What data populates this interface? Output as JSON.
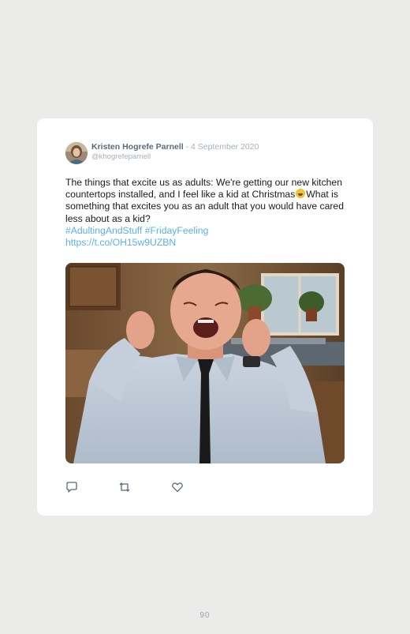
{
  "tweet": {
    "author_name": "Kristen Hogrefe Parnell",
    "separator": " - ",
    "date": "4 September 2020",
    "handle": "@khogrefeparnell",
    "text_before_emoji": "The things that excite us as adults: We're getting our new kitchen countertops installed, and I feel like a kid at Christmas",
    "emoji_icon": "grinning-face-icon",
    "text_after_emoji": "What is something that excites you as an adult that you would have cared less about as a kid?",
    "hashtag_1": "#AdultingAndStuff",
    "hashtag_2": "#FridayFeeling",
    "link": "https://t.co/OH15w9UZBN",
    "media_description_icon": "animated-gif-image",
    "actions": {
      "reply_icon": "reply-icon",
      "retweet_icon": "retweet-icon",
      "like_icon": "heart-icon"
    }
  },
  "page": {
    "number": "90"
  },
  "colors": {
    "background": "#ebebea",
    "card": "#ffffff",
    "link": "#5ab2e6",
    "meta": "#a6b0b9",
    "name": "#5b6a78"
  }
}
